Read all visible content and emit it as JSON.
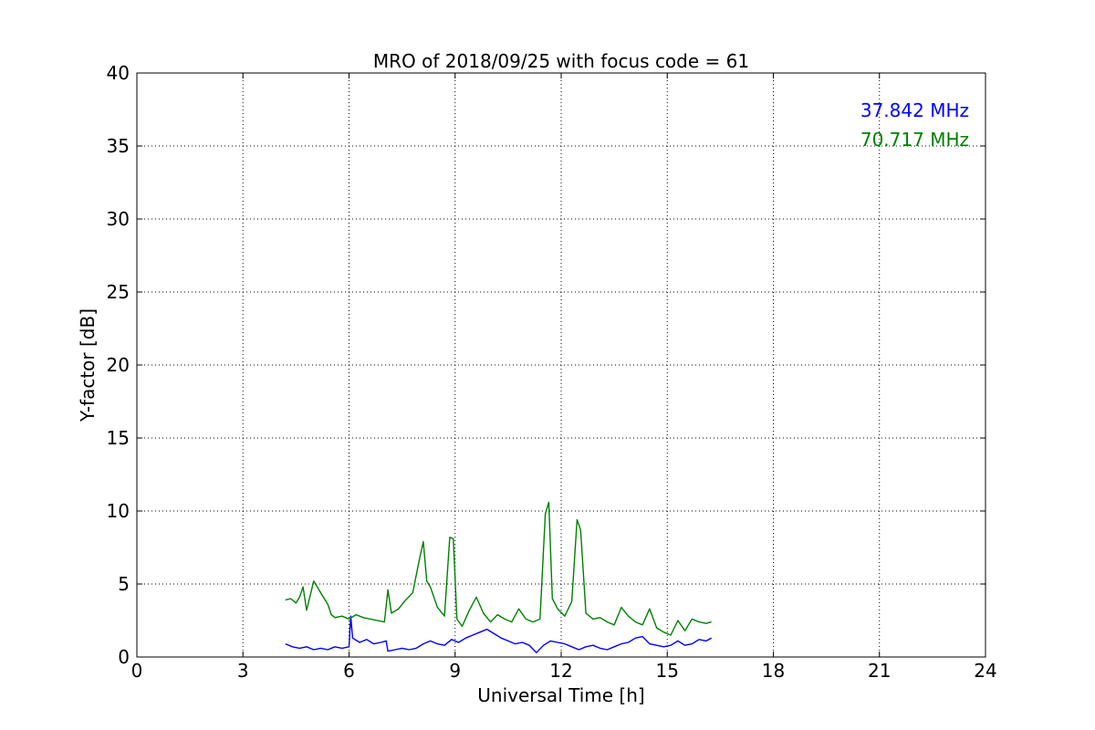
{
  "chart_data": {
    "type": "line",
    "title": "MRO of 2018/09/25 with focus code = 61",
    "xlabel": "Universal Time [h]",
    "ylabel": "Y-factor [dB]",
    "xlim": [
      0,
      24
    ],
    "ylim": [
      0,
      40
    ],
    "xticks": [
      0,
      3,
      6,
      9,
      12,
      15,
      18,
      21,
      24
    ],
    "yticks": [
      0,
      5,
      10,
      15,
      20,
      25,
      30,
      35,
      40
    ],
    "xtick_labels": [
      "0",
      "3",
      "6",
      "9",
      "12",
      "15",
      "18",
      "21",
      "24"
    ],
    "ytick_labels": [
      "0",
      "5",
      "10",
      "15",
      "20",
      "25",
      "30",
      "35",
      "40"
    ],
    "grid": true,
    "legend_position": "top-right",
    "series": [
      {
        "name": "37.842 MHz",
        "color": "#0000ff",
        "x": [
          4.2,
          4.4,
          4.6,
          4.8,
          5.0,
          5.2,
          5.4,
          5.6,
          5.8,
          6.0,
          6.05,
          6.1,
          6.3,
          6.5,
          6.7,
          6.9,
          7.05,
          7.1,
          7.3,
          7.5,
          7.7,
          7.9,
          8.1,
          8.3,
          8.5,
          8.7,
          8.9,
          9.1,
          9.3,
          9.5,
          9.7,
          9.9,
          10.1,
          10.3,
          10.5,
          10.7,
          10.9,
          11.1,
          11.3,
          11.5,
          11.7,
          11.9,
          12.1,
          12.3,
          12.5,
          12.7,
          12.9,
          13.1,
          13.3,
          13.5,
          13.7,
          13.9,
          14.1,
          14.3,
          14.5,
          14.7,
          14.9,
          15.1,
          15.3,
          15.5,
          15.7,
          15.9,
          16.1,
          16.25
        ],
        "y": [
          0.9,
          0.7,
          0.6,
          0.7,
          0.5,
          0.6,
          0.5,
          0.7,
          0.6,
          0.7,
          2.8,
          1.3,
          1.0,
          1.2,
          0.9,
          1.0,
          1.1,
          0.4,
          0.5,
          0.6,
          0.5,
          0.6,
          0.9,
          1.1,
          0.9,
          0.8,
          1.2,
          1.0,
          1.3,
          1.5,
          1.7,
          1.9,
          1.6,
          1.3,
          1.1,
          0.9,
          1.0,
          0.8,
          0.3,
          0.8,
          1.1,
          1.0,
          0.9,
          0.7,
          0.5,
          0.7,
          0.8,
          0.6,
          0.5,
          0.7,
          0.9,
          1.0,
          1.3,
          1.4,
          0.9,
          0.8,
          0.7,
          0.8,
          1.1,
          0.8,
          0.9,
          1.2,
          1.1,
          1.3
        ]
      },
      {
        "name": "70.717 MHz",
        "color": "#008000",
        "x": [
          4.2,
          4.35,
          4.5,
          4.6,
          4.7,
          4.8,
          5.0,
          5.2,
          5.4,
          5.5,
          5.6,
          5.8,
          6.0,
          6.2,
          6.4,
          6.6,
          6.8,
          7.0,
          7.1,
          7.2,
          7.4,
          7.6,
          7.8,
          8.0,
          8.1,
          8.2,
          8.3,
          8.5,
          8.7,
          8.85,
          8.95,
          9.05,
          9.2,
          9.4,
          9.6,
          9.8,
          10.0,
          10.2,
          10.4,
          10.6,
          10.8,
          11.0,
          11.2,
          11.4,
          11.55,
          11.65,
          11.75,
          11.9,
          12.1,
          12.3,
          12.45,
          12.55,
          12.7,
          12.9,
          13.1,
          13.3,
          13.5,
          13.7,
          13.9,
          14.1,
          14.3,
          14.5,
          14.7,
          14.9,
          15.1,
          15.3,
          15.5,
          15.7,
          15.9,
          16.1,
          16.25
        ],
        "y": [
          3.9,
          4.0,
          3.7,
          4.1,
          4.8,
          3.2,
          5.2,
          4.4,
          3.6,
          2.9,
          2.7,
          2.8,
          2.6,
          2.9,
          2.7,
          2.6,
          2.5,
          2.4,
          4.6,
          3.0,
          3.3,
          3.9,
          4.4,
          6.8,
          7.9,
          5.2,
          4.8,
          3.4,
          2.8,
          8.2,
          8.1,
          2.6,
          2.1,
          3.2,
          4.1,
          3.0,
          2.4,
          2.9,
          2.6,
          2.4,
          3.3,
          2.6,
          2.4,
          2.6,
          9.8,
          10.6,
          4.0,
          3.3,
          2.8,
          3.8,
          9.4,
          8.7,
          3.0,
          2.6,
          2.7,
          2.4,
          2.2,
          3.4,
          2.8,
          2.4,
          2.2,
          3.3,
          2.0,
          1.7,
          1.5,
          2.5,
          1.8,
          2.6,
          2.4,
          2.3,
          2.4
        ]
      }
    ]
  }
}
